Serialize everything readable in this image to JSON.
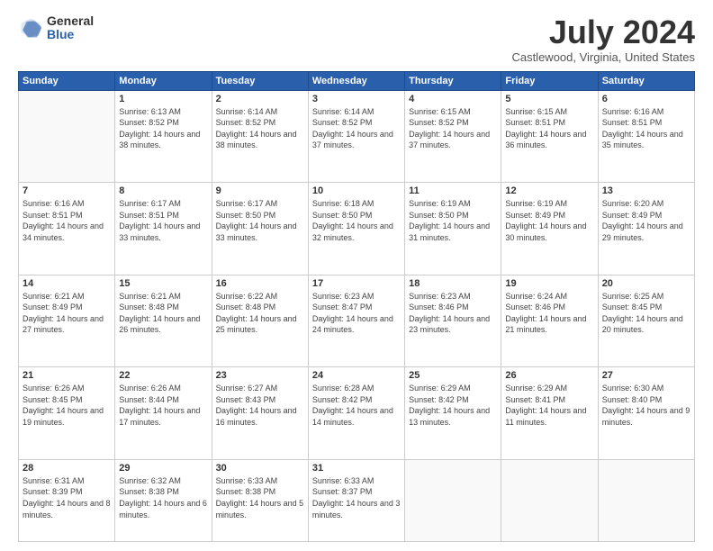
{
  "logo": {
    "general": "General",
    "blue": "Blue"
  },
  "header": {
    "month_year": "July 2024",
    "location": "Castlewood, Virginia, United States"
  },
  "days_of_week": [
    "Sunday",
    "Monday",
    "Tuesday",
    "Wednesday",
    "Thursday",
    "Friday",
    "Saturday"
  ],
  "weeks": [
    [
      {
        "day": "",
        "sunrise": "",
        "sunset": "",
        "daylight": ""
      },
      {
        "day": "1",
        "sunrise": "Sunrise: 6:13 AM",
        "sunset": "Sunset: 8:52 PM",
        "daylight": "Daylight: 14 hours and 38 minutes."
      },
      {
        "day": "2",
        "sunrise": "Sunrise: 6:14 AM",
        "sunset": "Sunset: 8:52 PM",
        "daylight": "Daylight: 14 hours and 38 minutes."
      },
      {
        "day": "3",
        "sunrise": "Sunrise: 6:14 AM",
        "sunset": "Sunset: 8:52 PM",
        "daylight": "Daylight: 14 hours and 37 minutes."
      },
      {
        "day": "4",
        "sunrise": "Sunrise: 6:15 AM",
        "sunset": "Sunset: 8:52 PM",
        "daylight": "Daylight: 14 hours and 37 minutes."
      },
      {
        "day": "5",
        "sunrise": "Sunrise: 6:15 AM",
        "sunset": "Sunset: 8:51 PM",
        "daylight": "Daylight: 14 hours and 36 minutes."
      },
      {
        "day": "6",
        "sunrise": "Sunrise: 6:16 AM",
        "sunset": "Sunset: 8:51 PM",
        "daylight": "Daylight: 14 hours and 35 minutes."
      }
    ],
    [
      {
        "day": "7",
        "sunrise": "Sunrise: 6:16 AM",
        "sunset": "Sunset: 8:51 PM",
        "daylight": "Daylight: 14 hours and 34 minutes."
      },
      {
        "day": "8",
        "sunrise": "Sunrise: 6:17 AM",
        "sunset": "Sunset: 8:51 PM",
        "daylight": "Daylight: 14 hours and 33 minutes."
      },
      {
        "day": "9",
        "sunrise": "Sunrise: 6:17 AM",
        "sunset": "Sunset: 8:50 PM",
        "daylight": "Daylight: 14 hours and 33 minutes."
      },
      {
        "day": "10",
        "sunrise": "Sunrise: 6:18 AM",
        "sunset": "Sunset: 8:50 PM",
        "daylight": "Daylight: 14 hours and 32 minutes."
      },
      {
        "day": "11",
        "sunrise": "Sunrise: 6:19 AM",
        "sunset": "Sunset: 8:50 PM",
        "daylight": "Daylight: 14 hours and 31 minutes."
      },
      {
        "day": "12",
        "sunrise": "Sunrise: 6:19 AM",
        "sunset": "Sunset: 8:49 PM",
        "daylight": "Daylight: 14 hours and 30 minutes."
      },
      {
        "day": "13",
        "sunrise": "Sunrise: 6:20 AM",
        "sunset": "Sunset: 8:49 PM",
        "daylight": "Daylight: 14 hours and 29 minutes."
      }
    ],
    [
      {
        "day": "14",
        "sunrise": "Sunrise: 6:21 AM",
        "sunset": "Sunset: 8:49 PM",
        "daylight": "Daylight: 14 hours and 27 minutes."
      },
      {
        "day": "15",
        "sunrise": "Sunrise: 6:21 AM",
        "sunset": "Sunset: 8:48 PM",
        "daylight": "Daylight: 14 hours and 26 minutes."
      },
      {
        "day": "16",
        "sunrise": "Sunrise: 6:22 AM",
        "sunset": "Sunset: 8:48 PM",
        "daylight": "Daylight: 14 hours and 25 minutes."
      },
      {
        "day": "17",
        "sunrise": "Sunrise: 6:23 AM",
        "sunset": "Sunset: 8:47 PM",
        "daylight": "Daylight: 14 hours and 24 minutes."
      },
      {
        "day": "18",
        "sunrise": "Sunrise: 6:23 AM",
        "sunset": "Sunset: 8:46 PM",
        "daylight": "Daylight: 14 hours and 23 minutes."
      },
      {
        "day": "19",
        "sunrise": "Sunrise: 6:24 AM",
        "sunset": "Sunset: 8:46 PM",
        "daylight": "Daylight: 14 hours and 21 minutes."
      },
      {
        "day": "20",
        "sunrise": "Sunrise: 6:25 AM",
        "sunset": "Sunset: 8:45 PM",
        "daylight": "Daylight: 14 hours and 20 minutes."
      }
    ],
    [
      {
        "day": "21",
        "sunrise": "Sunrise: 6:26 AM",
        "sunset": "Sunset: 8:45 PM",
        "daylight": "Daylight: 14 hours and 19 minutes."
      },
      {
        "day": "22",
        "sunrise": "Sunrise: 6:26 AM",
        "sunset": "Sunset: 8:44 PM",
        "daylight": "Daylight: 14 hours and 17 minutes."
      },
      {
        "day": "23",
        "sunrise": "Sunrise: 6:27 AM",
        "sunset": "Sunset: 8:43 PM",
        "daylight": "Daylight: 14 hours and 16 minutes."
      },
      {
        "day": "24",
        "sunrise": "Sunrise: 6:28 AM",
        "sunset": "Sunset: 8:42 PM",
        "daylight": "Daylight: 14 hours and 14 minutes."
      },
      {
        "day": "25",
        "sunrise": "Sunrise: 6:29 AM",
        "sunset": "Sunset: 8:42 PM",
        "daylight": "Daylight: 14 hours and 13 minutes."
      },
      {
        "day": "26",
        "sunrise": "Sunrise: 6:29 AM",
        "sunset": "Sunset: 8:41 PM",
        "daylight": "Daylight: 14 hours and 11 minutes."
      },
      {
        "day": "27",
        "sunrise": "Sunrise: 6:30 AM",
        "sunset": "Sunset: 8:40 PM",
        "daylight": "Daylight: 14 hours and 9 minutes."
      }
    ],
    [
      {
        "day": "28",
        "sunrise": "Sunrise: 6:31 AM",
        "sunset": "Sunset: 8:39 PM",
        "daylight": "Daylight: 14 hours and 8 minutes."
      },
      {
        "day": "29",
        "sunrise": "Sunrise: 6:32 AM",
        "sunset": "Sunset: 8:38 PM",
        "daylight": "Daylight: 14 hours and 6 minutes."
      },
      {
        "day": "30",
        "sunrise": "Sunrise: 6:33 AM",
        "sunset": "Sunset: 8:38 PM",
        "daylight": "Daylight: 14 hours and 5 minutes."
      },
      {
        "day": "31",
        "sunrise": "Sunrise: 6:33 AM",
        "sunset": "Sunset: 8:37 PM",
        "daylight": "Daylight: 14 hours and 3 minutes."
      },
      {
        "day": "",
        "sunrise": "",
        "sunset": "",
        "daylight": ""
      },
      {
        "day": "",
        "sunrise": "",
        "sunset": "",
        "daylight": ""
      },
      {
        "day": "",
        "sunrise": "",
        "sunset": "",
        "daylight": ""
      }
    ]
  ]
}
